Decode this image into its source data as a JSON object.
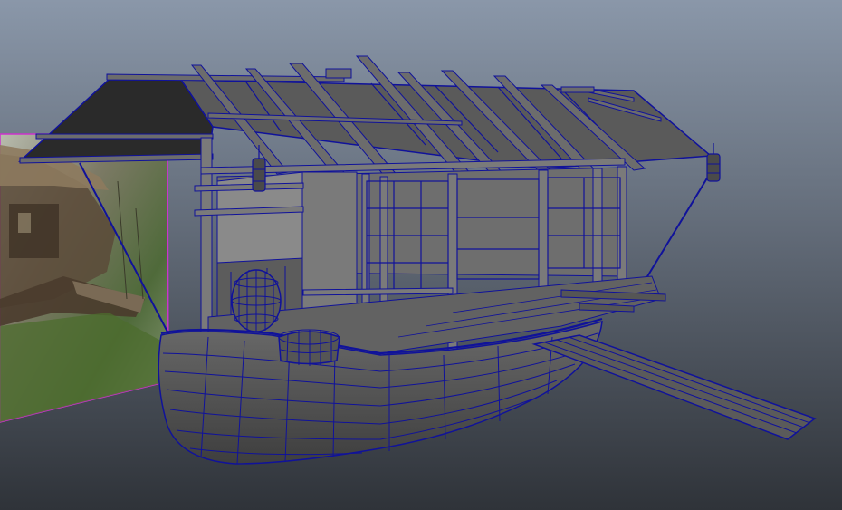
{
  "viewport": {
    "background_top": "#8a97a9",
    "background_bottom": "#2f3339",
    "wireframe_color": "#10129a",
    "selection_outline_color": "#cc33cc",
    "mesh_fill_color": "#5e5e5e",
    "mesh_dark_fill_color": "#3f3f3f"
  },
  "scene": {
    "objects": [
      {
        "name": "reference-image-plane",
        "icon": "image-plane-icon"
      },
      {
        "name": "boat-hull"
      },
      {
        "name": "roof"
      },
      {
        "name": "cabin"
      },
      {
        "name": "barrel"
      },
      {
        "name": "basket"
      },
      {
        "name": "lantern-left"
      },
      {
        "name": "lantern-right"
      },
      {
        "name": "gangplank"
      }
    ]
  }
}
